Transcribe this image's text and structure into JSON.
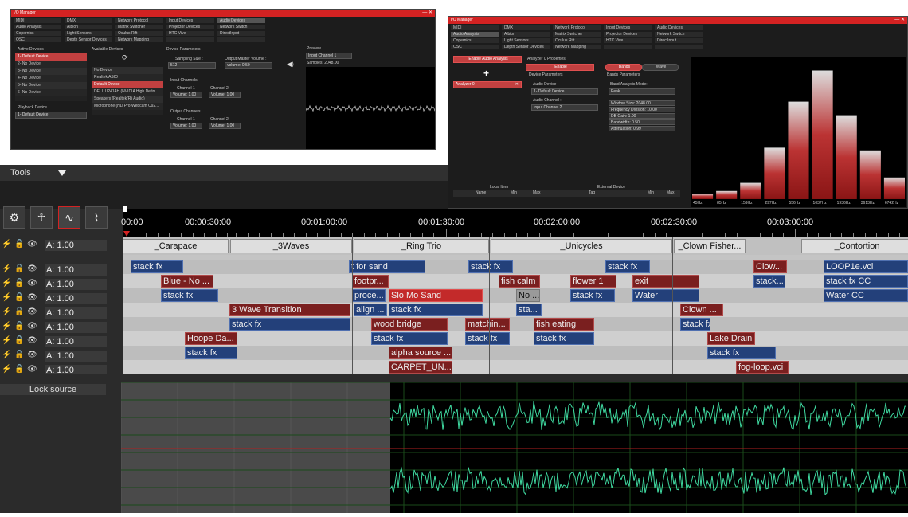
{
  "win1": {
    "title": "I/O Manager",
    "close": "—  ✕",
    "menu": [
      [
        "MIDI",
        "Audio Analysis",
        "Copernics",
        "OSC"
      ],
      [
        "DMX",
        "Albion",
        "Light Sensors",
        "Depth Sensor Devices"
      ],
      [
        "Network Protocol",
        "Matrix Switcher",
        "Oculus Rift",
        "Network Mapping"
      ],
      [
        "Input Devices",
        "Projector Devices",
        "HTC Vive",
        ""
      ],
      [
        "Audio Devices",
        "Network Switch",
        "DirectInput",
        ""
      ]
    ],
    "active_devices_label": "Active Devices",
    "active_devices": [
      "1- Default Device",
      "2- No Device",
      "3- No Device",
      "4- No Device",
      "5- No Device",
      "6- No Device"
    ],
    "playback_label": "Playback Device",
    "playback_value": "1- Default Device",
    "available_label": "Available Devices",
    "available": [
      "No Device",
      "Realtek ASIO",
      "Default Device",
      "DELL U2414H (NVIDIA High Defin...",
      "Speakers (Realtek(R) Audio)",
      "Microphone (HD Pro Webcam C92..."
    ],
    "params_label": "Device Parameters",
    "sampling_label": "Sampling Size :",
    "sampling_value": "512",
    "master_label": "Output Master Volume :",
    "master_value": "volume: 0.50",
    "input_channels_label": "Input Channels",
    "output_channels_label": "Output Channels",
    "ch1": "Channel 1",
    "ch2": "Channel 2",
    "vol": "Volume: 1.00",
    "preview_label": "Preview",
    "preview_value": "Input Channel 1",
    "samples": "Samples: 2048.00"
  },
  "win2": {
    "title": "I/O Manager",
    "close": "—  ✕",
    "menu": [
      [
        "MIDI",
        "Audio Analysis",
        "Copernics",
        "OSC"
      ],
      [
        "DMX",
        "Albion",
        "Light Sensors",
        "Depth Sensor Devices"
      ],
      [
        "Network Protocol",
        "Matrix Switcher",
        "Oculus Rift",
        "Network Mapping"
      ],
      [
        "Input Devices",
        "Projector Devices",
        "HTC Vive",
        ""
      ],
      [
        "Audio Devices",
        "Network Switch",
        "DirectInput",
        ""
      ]
    ],
    "enable_btn": "Enable Audio Analysis",
    "analyzer": "Analyzer 0",
    "props_label": "Analyzer 0 Properties",
    "enable": "Enable",
    "dev_params": "Device Parameters",
    "audio_dev_label": "Audio Device :",
    "audio_dev_value": "1- Default Device",
    "audio_ch_label": "Audio Channel :",
    "audio_ch_value": "Input Channel 2",
    "bands_tab": "Bands",
    "wave_tab": "Wave",
    "band_params": "Bands Parameters",
    "mode_label": "Band Analysis Mode:",
    "mode_value": "Peak",
    "window_size": "Window Size: 2048.00",
    "freq_div": "Frequency Division: 10.00",
    "db_gain": "DB Gain: 1.00",
    "bandwidth": "Bandwidth: 0.50",
    "attenuation": "Attenuation: 0.99",
    "local_item": "Local Item",
    "external_device": "External Device",
    "cols": [
      "Name",
      "Min",
      "Max",
      "Tag",
      "Min",
      "Max"
    ],
    "band_labels": [
      "45Hz",
      "85Hz",
      "159Hz",
      "297Hz",
      "556Hz",
      "1037Hz",
      "1936Hz",
      "3613Hz",
      "6742Hz"
    ],
    "band_levels": [
      0.04,
      0.06,
      0.12,
      0.38,
      0.72,
      0.95,
      0.62,
      0.36,
      0.16
    ]
  },
  "tools": {
    "label": "Tools"
  },
  "toolbar_icons": [
    "tuning-icon",
    "dancer-icon",
    "waveform-icon",
    "curve-icon"
  ],
  "ruler": {
    "ticks": [
      "00:00",
      "00:00:30:00",
      "00:01:00:00",
      "00:01:30:00",
      "00:02:00:00",
      "00:02:30:00",
      "00:03:00:00"
    ]
  },
  "cues": [
    "_Carapace",
    "_3Waves",
    "_Ring Trio",
    "_Unicycles",
    "_Clown Fisher...",
    "_Contortion"
  ],
  "row_volume": "A: 1.00",
  "tracks": [
    [
      [
        "stack fx",
        "blue"
      ],
      [
        "t for sand",
        "blue"
      ],
      [
        "stack fx",
        "blue"
      ],
      [
        "stack fx",
        "blue"
      ],
      [
        "Clow...",
        "red"
      ],
      [
        "LOOP1e.vci",
        "blue"
      ]
    ],
    [
      [
        "Blue - No ...",
        "red"
      ],
      [
        "footpr...",
        "red"
      ],
      [
        "fish calm",
        "red"
      ],
      [
        "flower 1",
        "red"
      ],
      [
        "exit",
        "red"
      ],
      [
        "stack...",
        "blue"
      ],
      [
        "stack fx  CC",
        "blue"
      ]
    ],
    [
      [
        "stack fx",
        "blue"
      ],
      [
        "proce...",
        "blue"
      ],
      [
        "Slo Mo Sand",
        "bred"
      ],
      [
        "No ...",
        "gray"
      ],
      [
        "stack fx",
        "blue"
      ],
      [
        "Water",
        "blue"
      ],
      [
        "Water  CC",
        "blue"
      ]
    ],
    [
      [
        "3 Wave Transition",
        "red"
      ],
      [
        "align ...",
        "blue"
      ],
      [
        "stack fx",
        "blue"
      ],
      [
        "sta...",
        "blue"
      ],
      [
        "Clown ...",
        "red"
      ]
    ],
    [
      [
        "stack fx",
        "blue"
      ],
      [
        "wood bridge",
        "red"
      ],
      [
        "matchin...",
        "red"
      ],
      [
        "fish eating",
        "red"
      ],
      [
        "stack fx",
        "blue"
      ]
    ],
    [
      [
        "Hoope Da...",
        "red"
      ],
      [
        "stack fx",
        "blue"
      ],
      [
        "stack fx",
        "blue"
      ],
      [
        "stack fx",
        "blue"
      ],
      [
        "Lake Drain",
        "red"
      ]
    ],
    [
      [
        "stack fx",
        "blue"
      ],
      [
        "alpha source ...",
        "red"
      ],
      [
        "stack fx",
        "blue"
      ]
    ],
    [
      [
        "CARPET_UN...",
        "red"
      ],
      [
        "fog-loop.vci",
        "red"
      ]
    ]
  ],
  "lock_source": "Lock source"
}
